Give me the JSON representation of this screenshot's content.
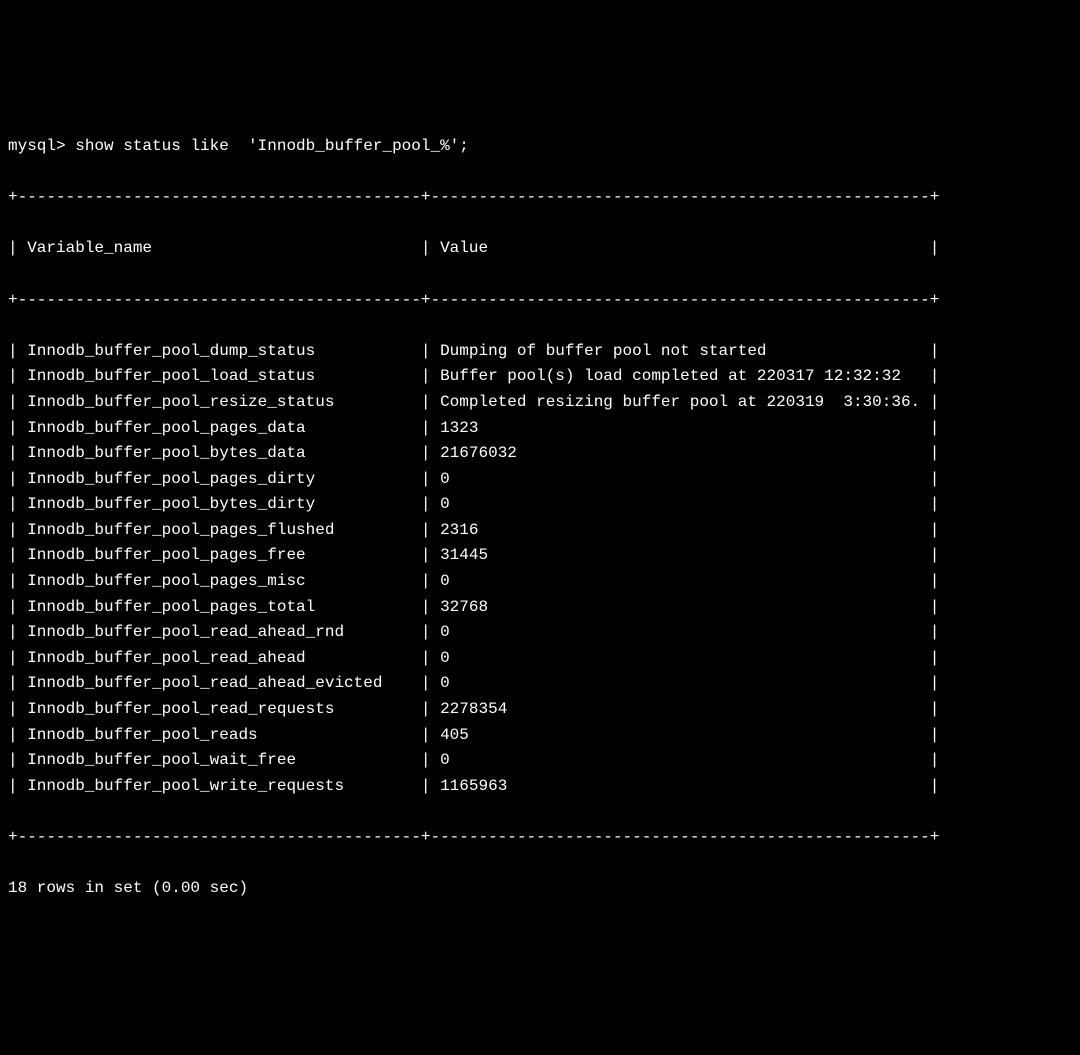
{
  "prompt": "mysql> ",
  "command": "show status like  'Innodb_buffer_pool_%';",
  "border_top": "+------------------------------------------+----------------------------------------------------+",
  "border_mid": "+------------------------------------------+----------------------------------------------------+",
  "border_bottom": "+------------------------------------------+----------------------------------------------------+",
  "headers": {
    "col1": "Variable_name",
    "col2": "Value"
  },
  "header_row": "| Variable_name                            | Value                                              |",
  "rows": [
    {
      "name": "Innodb_buffer_pool_dump_status",
      "value": "Dumping of buffer pool not started"
    },
    {
      "name": "Innodb_buffer_pool_load_status",
      "value": "Buffer pool(s) load completed at 220317 12:32:32"
    },
    {
      "name": "Innodb_buffer_pool_resize_status",
      "value": "Completed resizing buffer pool at 220319  3:30:36."
    },
    {
      "name": "Innodb_buffer_pool_pages_data",
      "value": "1323"
    },
    {
      "name": "Innodb_buffer_pool_bytes_data",
      "value": "21676032"
    },
    {
      "name": "Innodb_buffer_pool_pages_dirty",
      "value": "0"
    },
    {
      "name": "Innodb_buffer_pool_bytes_dirty",
      "value": "0"
    },
    {
      "name": "Innodb_buffer_pool_pages_flushed",
      "value": "2316"
    },
    {
      "name": "Innodb_buffer_pool_pages_free",
      "value": "31445"
    },
    {
      "name": "Innodb_buffer_pool_pages_misc",
      "value": "0"
    },
    {
      "name": "Innodb_buffer_pool_pages_total",
      "value": "32768"
    },
    {
      "name": "Innodb_buffer_pool_read_ahead_rnd",
      "value": "0"
    },
    {
      "name": "Innodb_buffer_pool_read_ahead",
      "value": "0"
    },
    {
      "name": "Innodb_buffer_pool_read_ahead_evicted",
      "value": "0"
    },
    {
      "name": "Innodb_buffer_pool_read_requests",
      "value": "2278354"
    },
    {
      "name": "Innodb_buffer_pool_reads",
      "value": "405"
    },
    {
      "name": "Innodb_buffer_pool_wait_free",
      "value": "0"
    },
    {
      "name": "Innodb_buffer_pool_write_requests",
      "value": "1165963"
    }
  ],
  "footer": "18 rows in set (0.00 sec)",
  "col1_width": 40,
  "col2_width": 50
}
